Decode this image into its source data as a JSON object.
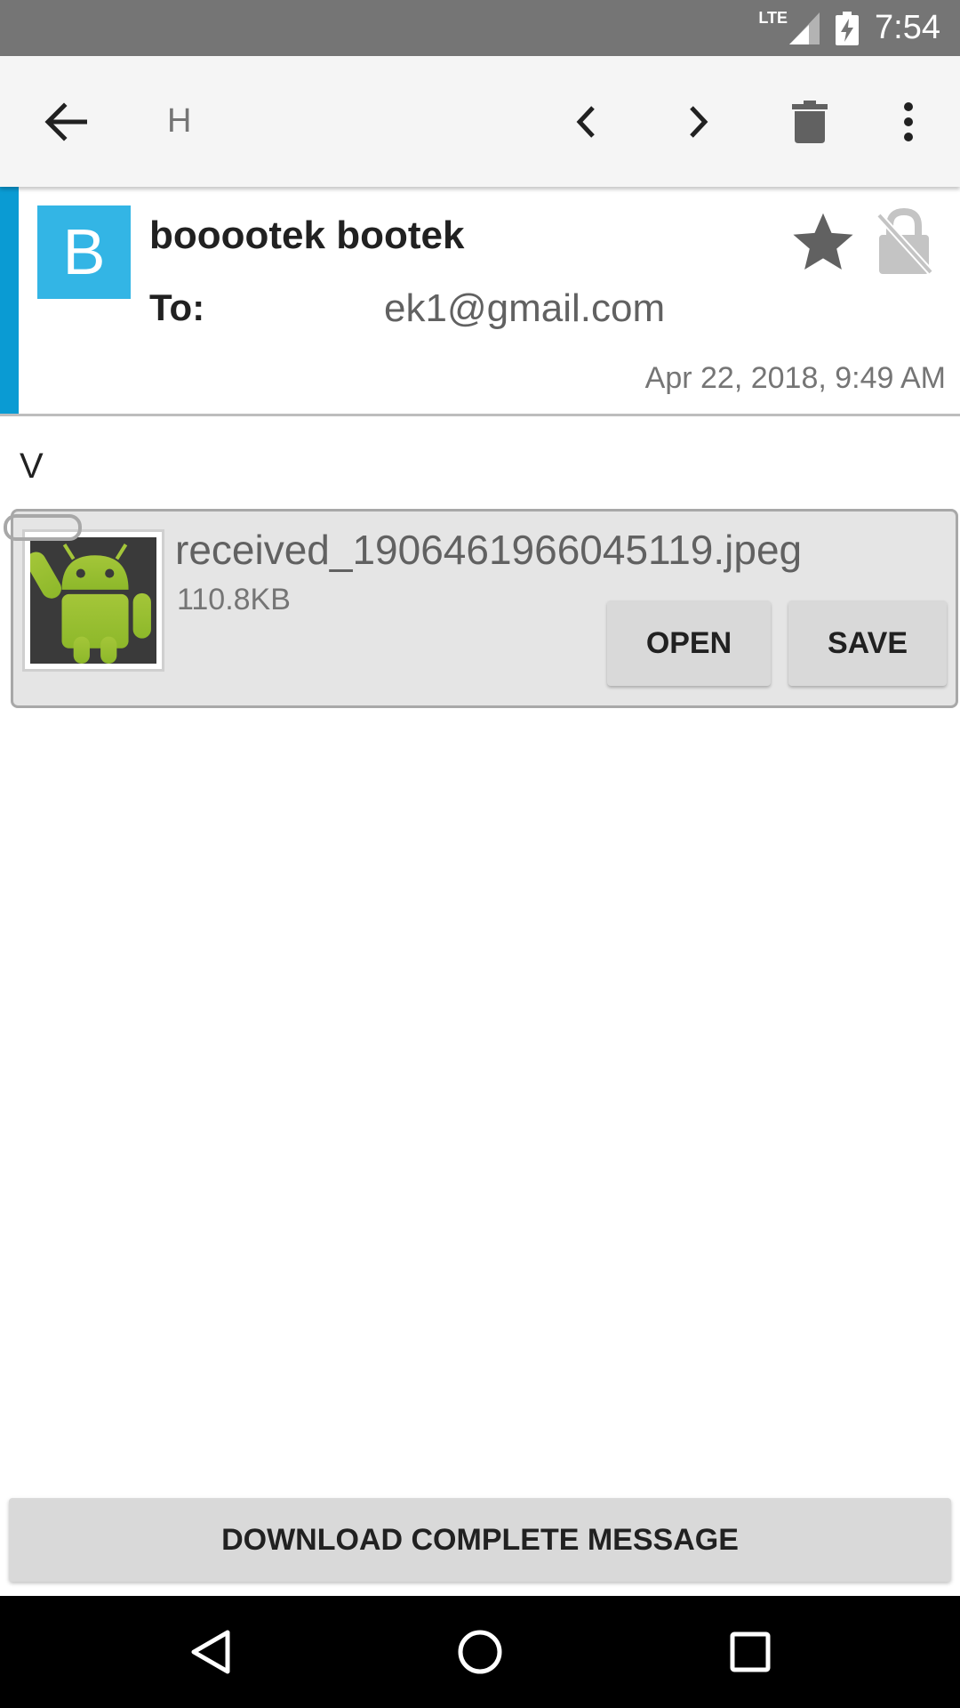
{
  "status_bar": {
    "network_label": "LTE",
    "time": "7:54"
  },
  "toolbar": {
    "title": "H",
    "icons": [
      "back-arrow-icon",
      "chevron-left-icon",
      "chevron-right-icon",
      "trash-icon",
      "more-vert-icon"
    ]
  },
  "message": {
    "avatar_letter": "B",
    "sender": "booootek bootek",
    "to_label": "To:",
    "to_value": "ek1@gmail.com",
    "date": "Apr 22, 2018, 9:49 AM",
    "body": "V",
    "accent_color": "#0a9bd3",
    "avatar_color": "#33b5e5"
  },
  "attachment": {
    "filename": "received_1906461966045119.jpeg",
    "size": "110.8KB",
    "open_label": "OPEN",
    "save_label": "SAVE"
  },
  "footer": {
    "download_label": "DOWNLOAD COMPLETE MESSAGE"
  }
}
